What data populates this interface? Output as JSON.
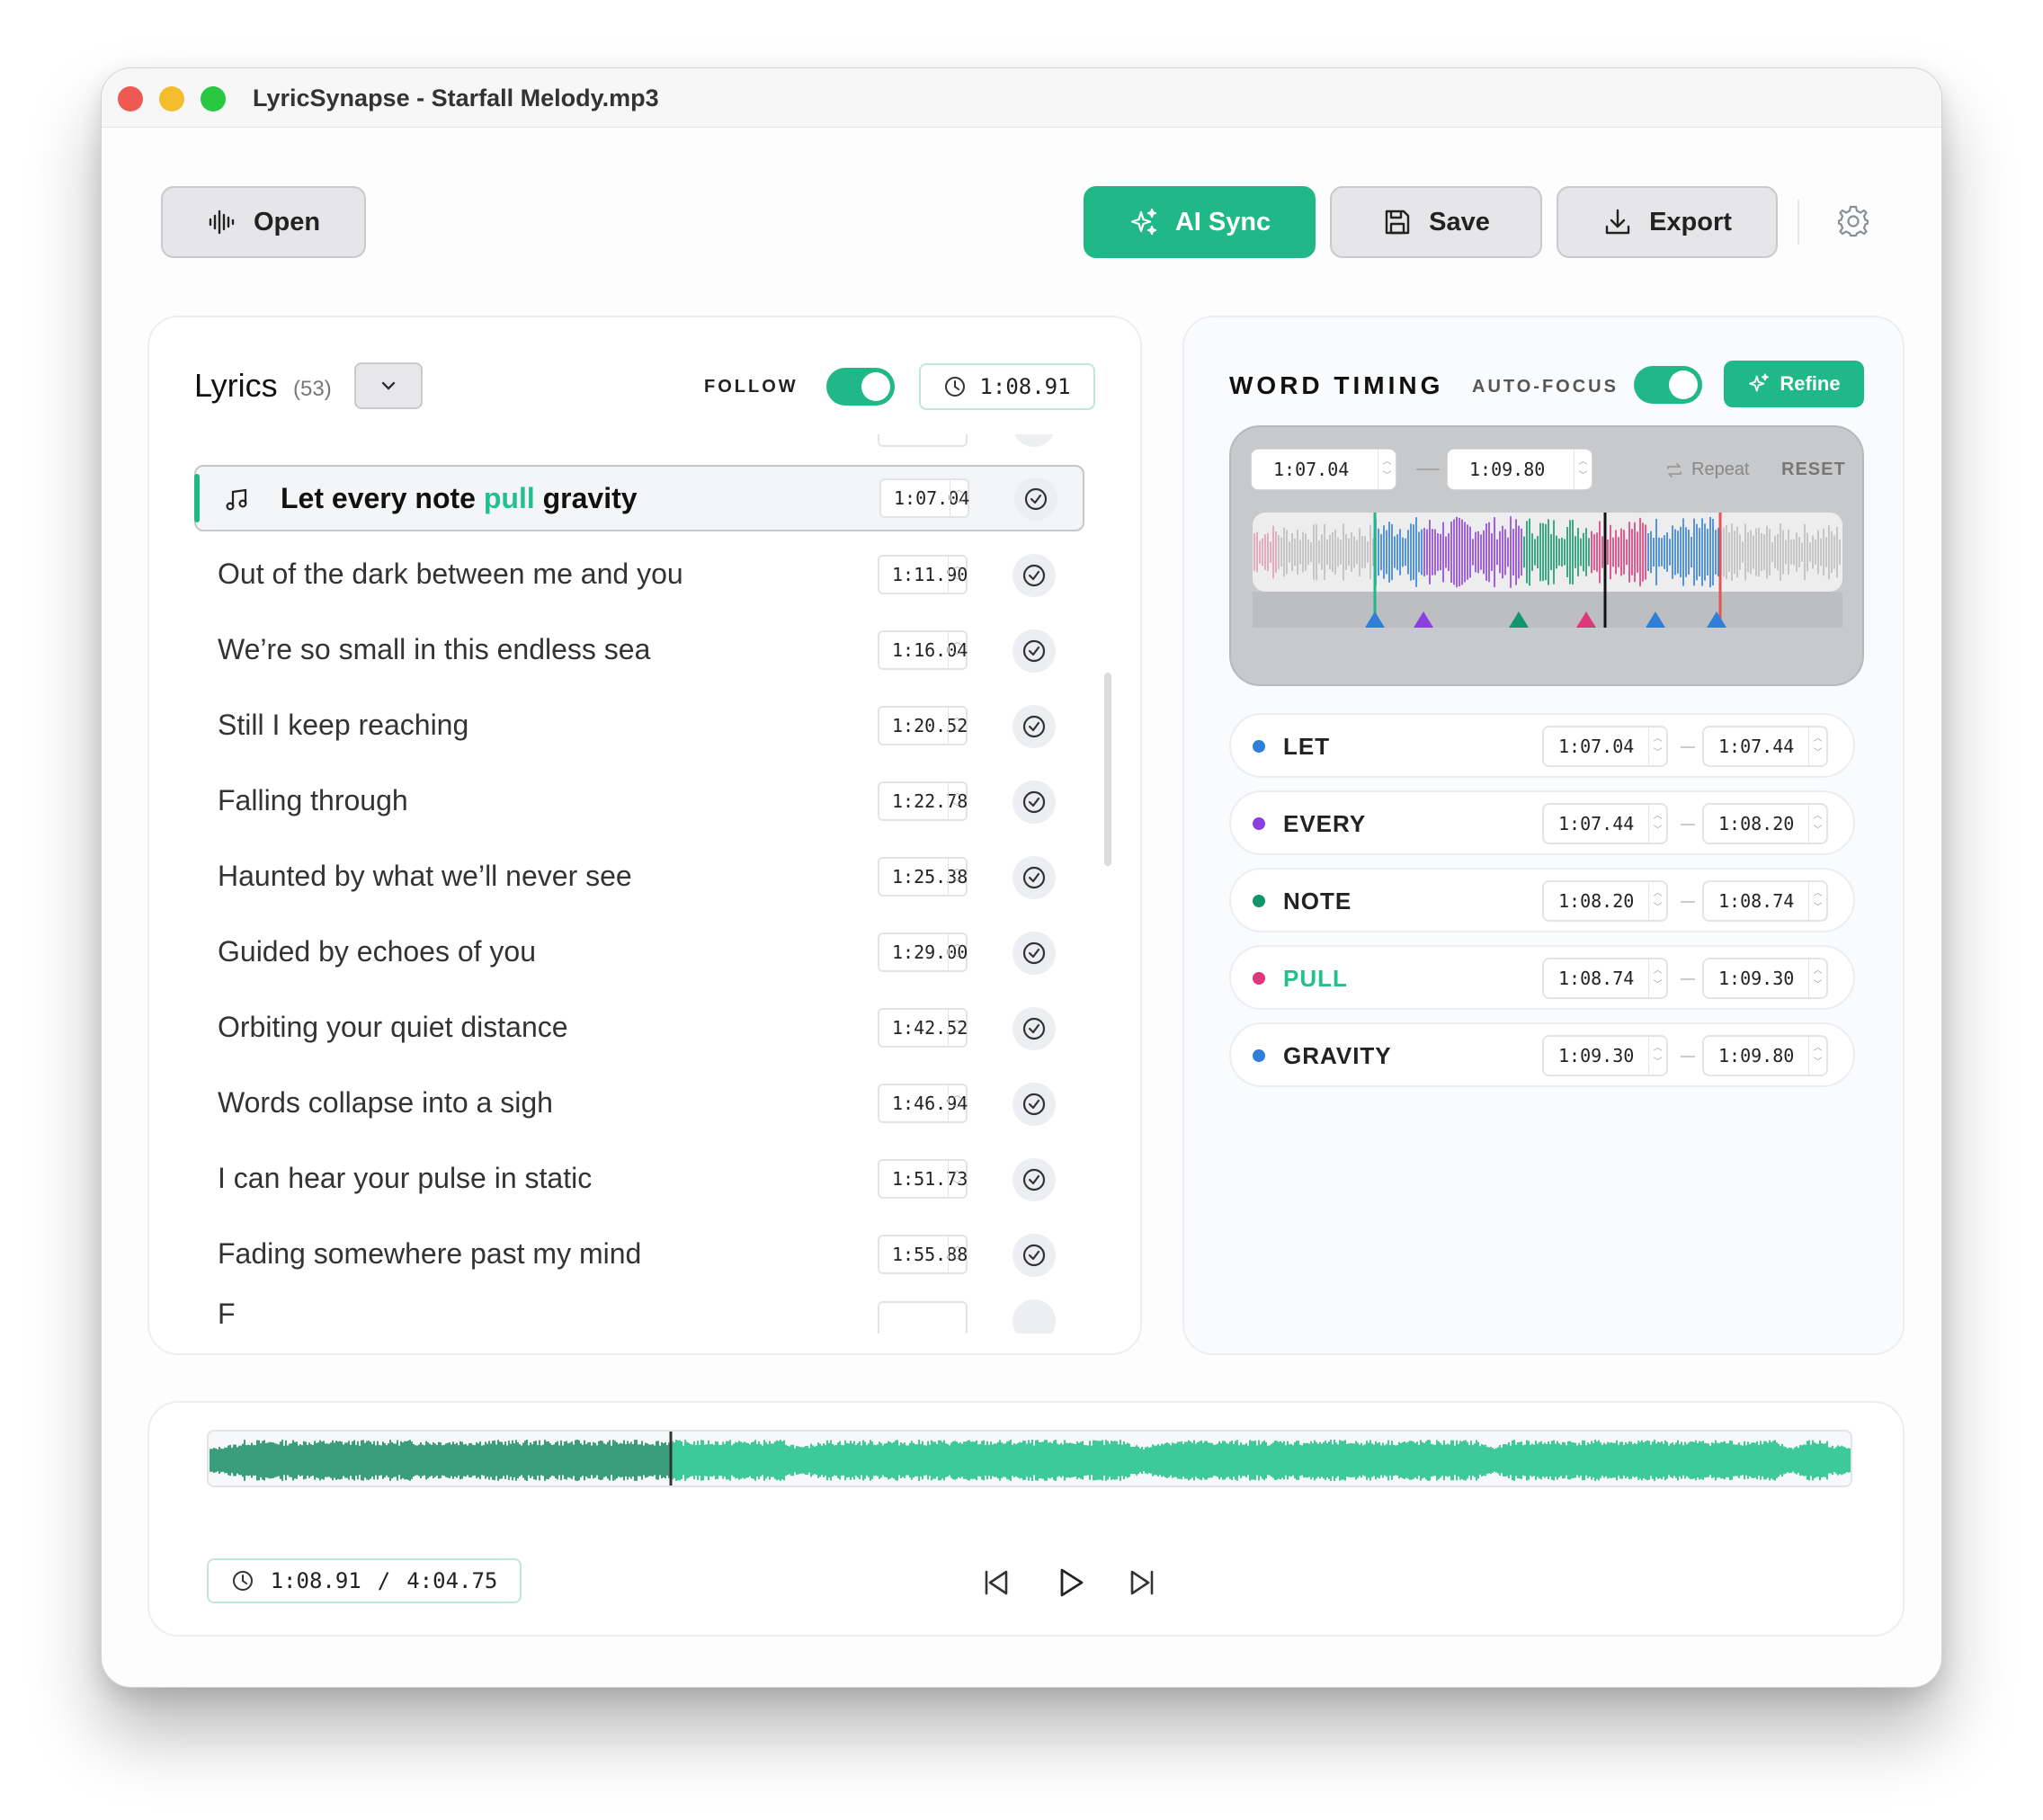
{
  "window": {
    "title": "LyricSynapse - Starfall Melody.mp3"
  },
  "toolbar": {
    "open_label": "Open",
    "ai_sync_label": "AI Sync",
    "save_label": "Save",
    "export_label": "Export"
  },
  "lyrics": {
    "title": "Lyrics",
    "count": "(53)",
    "follow_label": "FOLLOW",
    "current_time": "1:08.91",
    "active": {
      "before": "Let every note ",
      "highlight": "pull",
      "after": " gravity",
      "time": "1:07.04"
    },
    "rows": [
      {
        "text": "Out of the dark between me and you",
        "time": "1:11.90"
      },
      {
        "text": "We’re so small in this endless sea",
        "time": "1:16.04"
      },
      {
        "text": "Still I keep reaching",
        "time": "1:20.52"
      },
      {
        "text": "Falling through",
        "time": "1:22.78"
      },
      {
        "text": "Haunted by what we’ll never see",
        "time": "1:25.38"
      },
      {
        "text": "Guided by echoes of you",
        "time": "1:29.00"
      },
      {
        "text": "Orbiting your quiet distance",
        "time": "1:42.52"
      },
      {
        "text": "Words collapse into a sigh",
        "time": "1:46.94"
      },
      {
        "text": "I can hear your pulse in static",
        "time": "1:51.73"
      },
      {
        "text": "Fading somewhere past my mind",
        "time": "1:55.88"
      }
    ]
  },
  "word_timing": {
    "title": "WORD TIMING",
    "auto_focus_label": "AUTO-FOCUS",
    "refine_label": "Refine",
    "range_start": "1:07.04",
    "range_end": "1:09.80",
    "repeat_label": "Repeat",
    "reset_label": "RESET",
    "colors": {
      "let": "#2f7fd8",
      "every": "#8b3fe0",
      "note": "#10966a",
      "pull": "#e0367a",
      "gravity": "#2f7fd8"
    },
    "words": [
      {
        "label": "LET",
        "start": "1:07.04",
        "end": "1:07.44",
        "color": "#2f7fd8"
      },
      {
        "label": "EVERY",
        "start": "1:07.44",
        "end": "1:08.20",
        "color": "#8b3fe0"
      },
      {
        "label": "NOTE",
        "start": "1:08.20",
        "end": "1:08.74",
        "color": "#10966a"
      },
      {
        "label": "PULL",
        "start": "1:08.74",
        "end": "1:09.30",
        "color": "#e0367a"
      },
      {
        "label": "GRAVITY",
        "start": "1:09.30",
        "end": "1:09.80",
        "color": "#2f7fd8"
      }
    ]
  },
  "player": {
    "current": "1:08.91",
    "separator": "/",
    "total": "4:04.75",
    "progress": 0.281,
    "wave_color": "#3ec99a",
    "played_color": "#3a9e7d"
  }
}
